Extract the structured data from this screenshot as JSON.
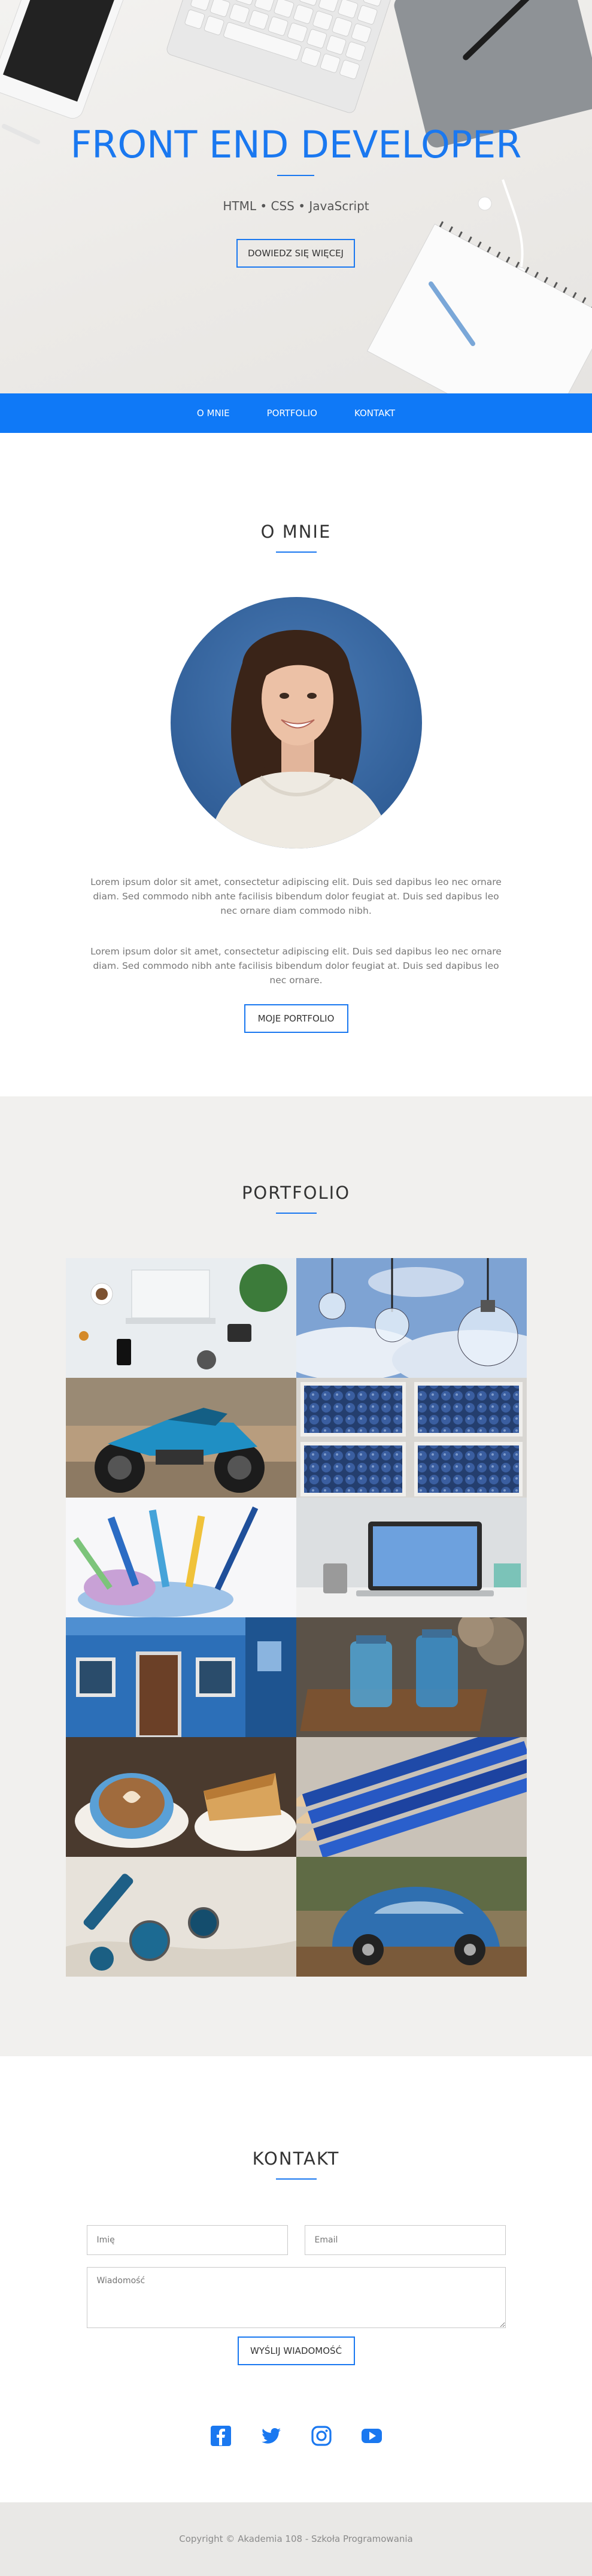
{
  "hero": {
    "title": "FRONT END DEVELOPER",
    "subtitle": "HTML • CSS • JavaScript",
    "button_label": "DOWIEDZ SIĘ WIĘCEJ"
  },
  "nav": {
    "items": [
      "O MNIE",
      "PORTFOLIO",
      "KONTAKT"
    ]
  },
  "about": {
    "title": "O MNIE",
    "paragraph_1": "Lorem ipsum dolor sit amet, consectetur adipiscing elit. Duis sed dapibus leo nec ornare diam. Sed commodo nibh ante facilisis bibendum dolor feugiat at. Duis sed dapibus leo nec ornare diam commodo nibh.",
    "paragraph_2": "Lorem ipsum dolor sit amet, consectetur adipiscing elit. Duis sed dapibus leo nec ornare diam. Sed commodo nibh ante facilisis bibendum dolor feugiat at. Duis sed dapibus leo nec ornare.",
    "button_label": "MOJE PORTFOLIO"
  },
  "portfolio": {
    "title": "PORTFOLIO",
    "tiles": [
      "laptop-desk",
      "light-bulbs",
      "motorcycle",
      "blueberries",
      "colored-pencils",
      "laptop-table",
      "blue-house",
      "blue-jars",
      "coffee-cake",
      "blue-pencils",
      "paint-cans",
      "vw-beetle"
    ]
  },
  "contact": {
    "title": "KONTAKT",
    "name_placeholder": "Imię",
    "email_placeholder": "Email",
    "message_placeholder": "Wiadomość",
    "button_label": "WYŚLIJ WIADOMOŚĆ",
    "socials": [
      "facebook-icon",
      "twitter-icon",
      "instagram-icon",
      "youtube-icon"
    ]
  },
  "colors": {
    "accent": "#1a78f0",
    "nav_bg": "#0f79f7",
    "portfolio_bg": "#f1f0ee",
    "footer_bg": "#e9e8e6"
  },
  "footer": {
    "copyright": "Copyright © Akademia 108 - Szkoła Programowania"
  }
}
